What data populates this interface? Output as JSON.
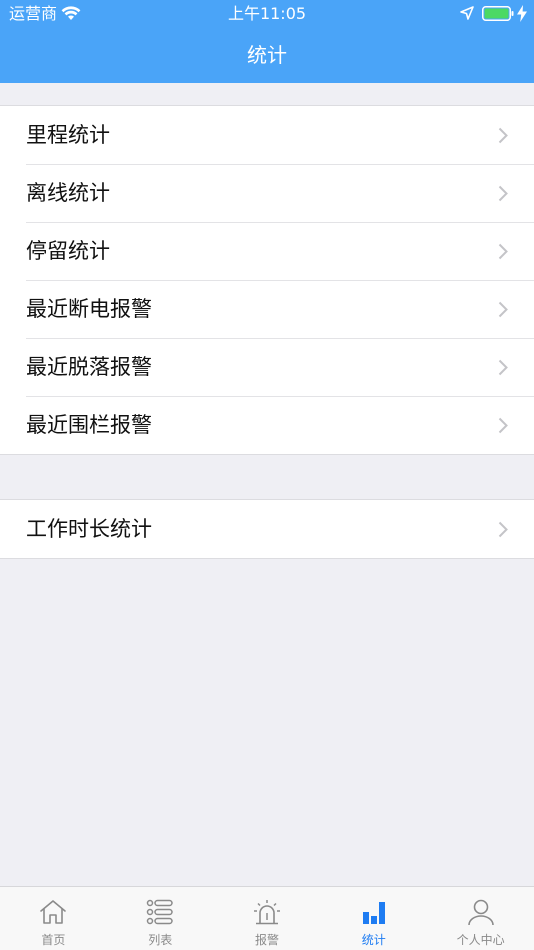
{
  "status_bar": {
    "carrier": "运营商",
    "time": "上午11:05"
  },
  "nav": {
    "title": "统计"
  },
  "groups": [
    {
      "items": [
        {
          "label": "里程统计"
        },
        {
          "label": "离线统计"
        },
        {
          "label": "停留统计"
        },
        {
          "label": "最近断电报警"
        },
        {
          "label": "最近脱落报警"
        },
        {
          "label": "最近围栏报警"
        }
      ]
    },
    {
      "items": [
        {
          "label": "工作时长统计"
        }
      ]
    }
  ],
  "tabs": [
    {
      "label": "首页",
      "icon": "home-icon",
      "active": false
    },
    {
      "label": "列表",
      "icon": "list-icon",
      "active": false
    },
    {
      "label": "报警",
      "icon": "alarm-icon",
      "active": false
    },
    {
      "label": "统计",
      "icon": "bar-chart-icon",
      "active": true
    },
    {
      "label": "个人中心",
      "icon": "user-icon",
      "active": false
    }
  ],
  "colors": {
    "header": "#4aa4f8",
    "active_tab": "#1e7cf2",
    "inactive_tab": "#8a8a8a",
    "battery_fill": "#4cd964"
  }
}
